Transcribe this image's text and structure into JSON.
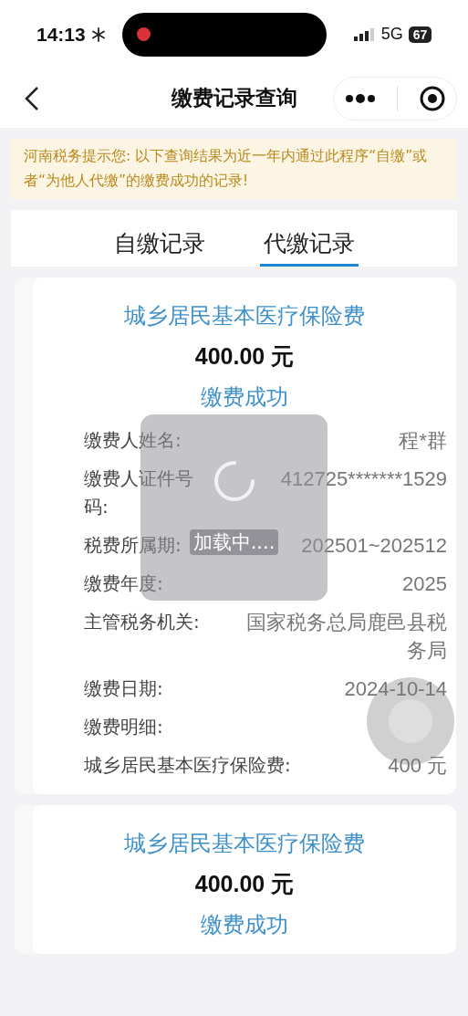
{
  "status_bar": {
    "time": "14:13",
    "network": "5G",
    "battery": "67"
  },
  "nav": {
    "title": "缴费记录查询"
  },
  "notice": "河南税务提示您: 以下查询结果为近一年内通过此程序“自缴”或者“为他人代缴”的缴费成功的记录!",
  "tabs": [
    {
      "label": "自缴记录",
      "selected": false
    },
    {
      "label": "代缴记录",
      "selected": true
    }
  ],
  "records": [
    {
      "title": "城乡居民基本医疗保险费",
      "amount": "400.00 元",
      "status": "缴费成功",
      "fields": [
        {
          "label": "缴费人姓名:",
          "value": "程*群"
        },
        {
          "label": "缴费人证件号码:",
          "value": "412725*******1529"
        },
        {
          "label": "税费所属期:",
          "value": "202501~202512"
        },
        {
          "label": "缴费年度:",
          "value": "2025"
        },
        {
          "label": "主管税务机关:",
          "value": "国家税务总局鹿邑县税务局"
        },
        {
          "label": "缴费日期:",
          "value": "2024-10-14"
        }
      ],
      "detail_heading": "缴费明细:",
      "details": [
        {
          "label": "城乡居民基本医疗保险费:",
          "value": "400 元"
        }
      ]
    },
    {
      "title": "城乡居民基本医疗保险费",
      "amount": "400.00 元",
      "status": "缴费成功"
    }
  ],
  "loading": {
    "text": "加载中...."
  }
}
